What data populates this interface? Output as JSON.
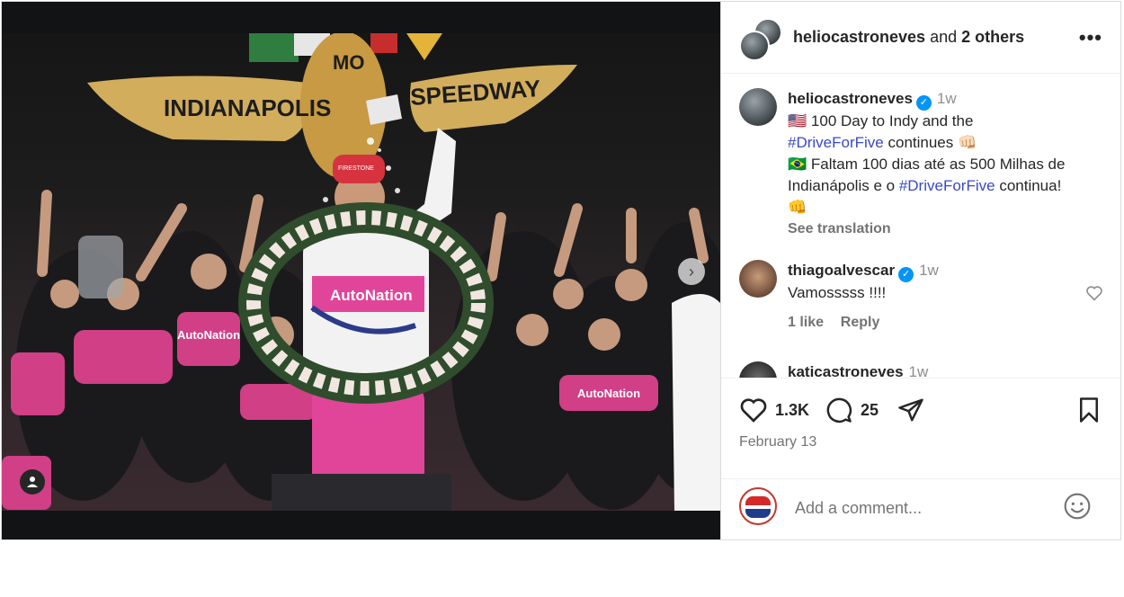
{
  "post": {
    "header": {
      "username": "heliocastroneves",
      "and_text": "and",
      "others": "2 others",
      "more_glyph": "•••"
    },
    "caption": {
      "username": "heliocastroneves",
      "time": "1w",
      "line1_flag": "🇺🇸",
      "line1_text": "100 Day to Indy and the",
      "hashtag1": "#DriveForFive",
      "line2_text": "continues",
      "line2_emoji": "👊🏻",
      "line3_flag": "🇧🇷",
      "line3_text": "Faltam 100 dias até as 500 Milhas de",
      "line4_text": "Indianápolis e o",
      "hashtag2": "#DriveForFive",
      "line4_end": "continua!",
      "line5_emoji": "👊",
      "see_translation": "See translation"
    },
    "comments": [
      {
        "username": "thiagoalvescar",
        "time": "1w",
        "text": "Vamosssss !!!!",
        "likes": "1 like",
        "reply": "Reply"
      },
      {
        "username": "katicastroneves",
        "time": "1w"
      }
    ],
    "stats": {
      "likes": "1.3K",
      "comments": "25",
      "date": "February 13"
    },
    "add_comment": {
      "placeholder": "Add a comment..."
    },
    "photo_text": {
      "left": "INDIANAPOLIS",
      "right": "SPEEDWAY",
      "mid": "MO",
      "cap": "FIRESTONE",
      "suit": "AutoNation",
      "sponsor1": "AutoNation",
      "sponsor2": "AutoNation"
    }
  }
}
